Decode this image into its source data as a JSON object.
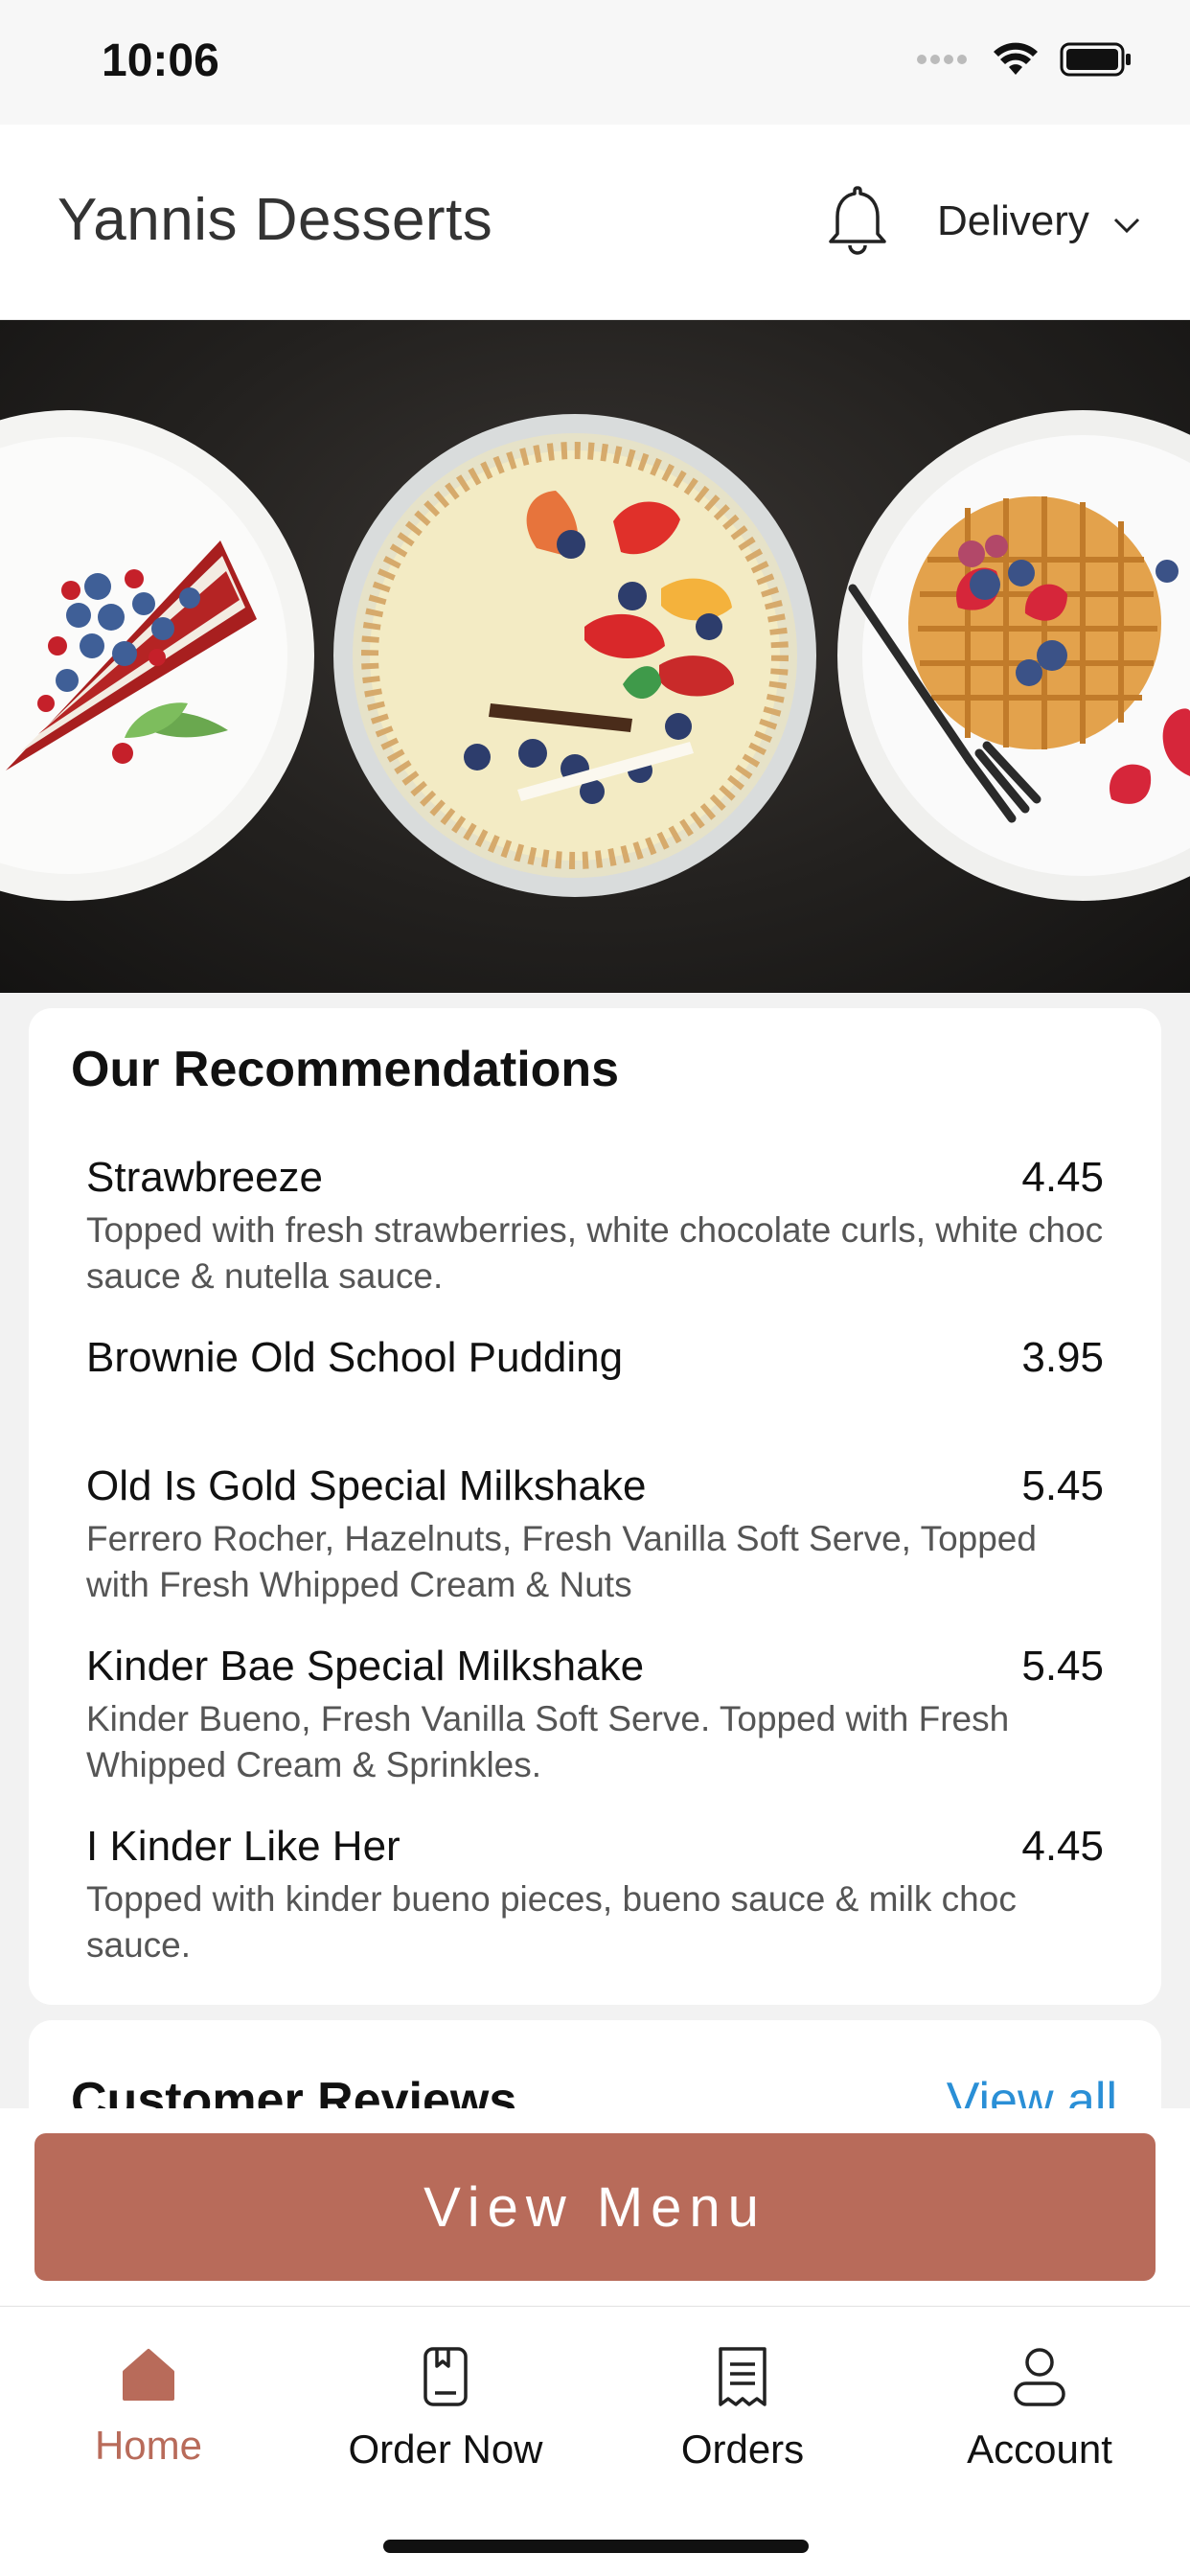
{
  "status_bar": {
    "time": "10:06"
  },
  "header": {
    "brand": "Yannis Desserts",
    "delivery_label": "Delivery"
  },
  "recommendations": {
    "title": "Our Recommendations",
    "items": [
      {
        "name": "Strawbreeze",
        "price": "4.45",
        "description": "Topped with fresh strawberries, white chocolate curls, white choc sauce & nutella sauce."
      },
      {
        "name": "Brownie Old School Pudding",
        "price": "3.95",
        "description": ""
      },
      {
        "name": "Old Is Gold Special Milkshake",
        "price": "5.45",
        "description": "Ferrero Rocher, Hazelnuts, Fresh Vanilla Soft Serve, Topped with Fresh Whipped Cream & Nuts"
      },
      {
        "name": "Kinder Bae Special Milkshake",
        "price": "5.45",
        "description": "Kinder Bueno, Fresh Vanilla Soft Serve. Topped with Fresh Whipped Cream & Sprinkles."
      },
      {
        "name": "I Kinder Like Her",
        "price": "4.45",
        "description": "Topped with kinder bueno pieces, bueno sauce & milk choc sauce."
      }
    ]
  },
  "reviews": {
    "title": "Customer Reviews",
    "view_all": "View all"
  },
  "cta": {
    "label": "View Menu"
  },
  "tabs": [
    {
      "label": "Home",
      "icon": "home-icon",
      "active": true
    },
    {
      "label": "Order Now",
      "icon": "order-now-icon",
      "active": false
    },
    {
      "label": "Orders",
      "icon": "receipt-icon",
      "active": false
    },
    {
      "label": "Account",
      "icon": "account-icon",
      "active": false
    }
  ],
  "colors": {
    "accent": "#b86b5a",
    "link": "#2a8fd6"
  }
}
